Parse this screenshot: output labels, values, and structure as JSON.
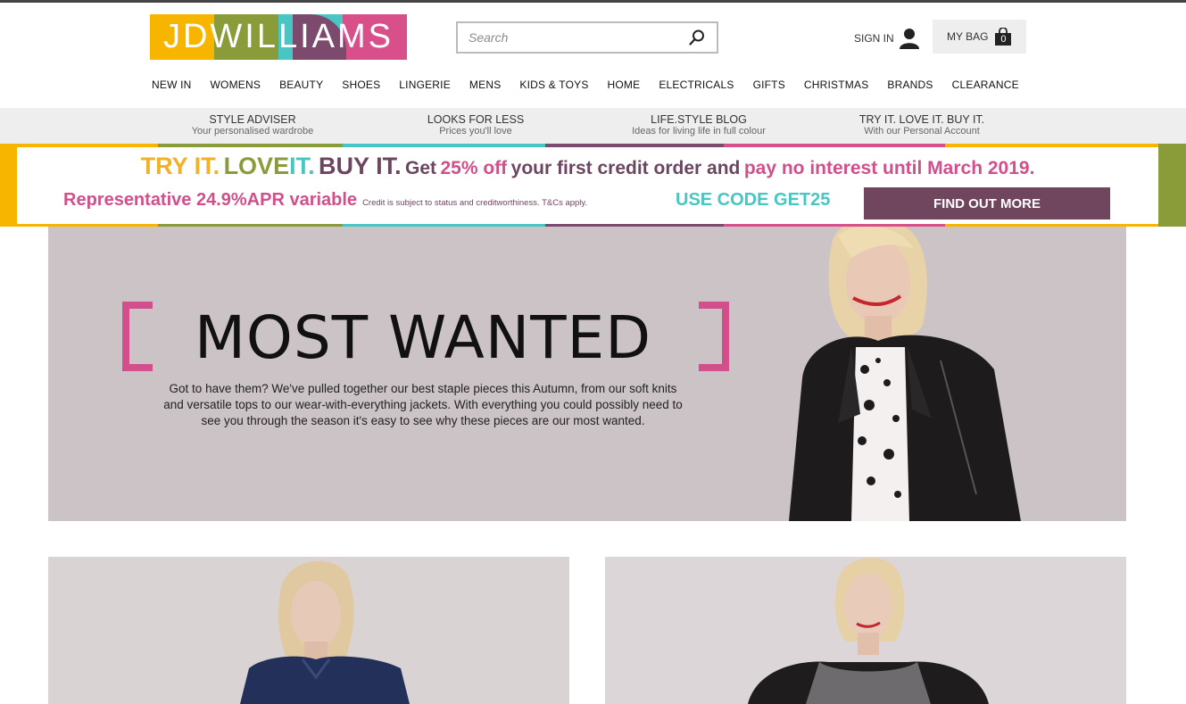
{
  "brand": {
    "logo_text": "JDWILLIAMS"
  },
  "search": {
    "placeholder": "Search"
  },
  "account": {
    "signin_label": "SIGN IN",
    "bag_label": "MY BAG",
    "bag_count": "0"
  },
  "main_nav": [
    "NEW IN",
    "WOMENS",
    "BEAUTY",
    "SHOES",
    "LINGERIE",
    "MENS",
    "KIDS & TOYS",
    "HOME",
    "ELECTRICALS",
    "GIFTS",
    "CHRISTMAS",
    "BRANDS",
    "CLEARANCE"
  ],
  "sub_nav": [
    {
      "title": "STYLE ADVISER",
      "subtitle": "Your personalised wardrobe"
    },
    {
      "title": "LOOKS FOR LESS",
      "subtitle": "Prices you'll love"
    },
    {
      "title": "LIFE.STYLE BLOG",
      "subtitle": "Ideas for living life in full colour"
    },
    {
      "title": "TRY IT. LOVE IT. BUY IT.",
      "subtitle": "With our Personal Account"
    }
  ],
  "promo": {
    "try": "TRY IT.",
    "love": "LOVE",
    "it": "IT.",
    "buy": "BUY IT.",
    "get": "Get",
    "off": "25% off",
    "order": "your first credit order and",
    "interest": "pay no interest until March 2019.",
    "representative": "Representative 24.9%APR variable",
    "fine_print": "Credit is subject to status and creditworthiness. T&Cs apply.",
    "code": "USE CODE GET25",
    "cta": "FIND OUT MORE"
  },
  "hero": {
    "title": "MOST WANTED",
    "body": "Got to have them? We've pulled together our best staple pieces this Autumn, from our soft knits and versatile tops to our wear-with-everything jackets. With everything you could possibly need to see you through the season it's easy to see why these pieces are our most wanted."
  },
  "colors": {
    "yellow": "#f7b500",
    "olive": "#8a9b3a",
    "teal": "#48c6c4",
    "plum": "#7c4a6c",
    "pink": "#d94f8a",
    "hero_bg": "#cbc3c6"
  }
}
